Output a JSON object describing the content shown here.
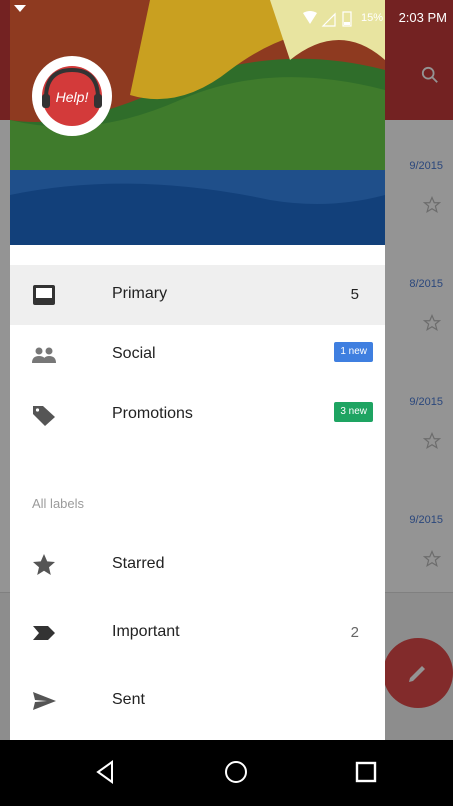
{
  "status_bar": {
    "battery_text": "15%",
    "time": "2:03 PM"
  },
  "background": {
    "dates": [
      "9/2015",
      "8/2015",
      "9/2015",
      "9/2015"
    ]
  },
  "drawer": {
    "logo_text": "Help!",
    "categories": [
      {
        "label": "Primary",
        "count": "5",
        "icon": "inbox-icon"
      },
      {
        "label": "Social",
        "badge": "1 new",
        "badge_color": "#3f7fe0",
        "icon": "people-icon"
      },
      {
        "label": "Promotions",
        "badge": "3 new",
        "badge_color": "#1ea462",
        "icon": "tag-icon"
      }
    ],
    "section_label": "All labels",
    "labels": [
      {
        "label": "Starred",
        "icon": "star-icon"
      },
      {
        "label": "Important",
        "count": "2",
        "icon": "important-icon"
      },
      {
        "label": "Sent",
        "icon": "send-icon"
      }
    ]
  },
  "colors": {
    "toolbar": "#c73b3b",
    "fab": "#e04b4b"
  },
  "nav_bar": {
    "icons": [
      "back-icon",
      "home-icon",
      "recents-icon"
    ]
  }
}
